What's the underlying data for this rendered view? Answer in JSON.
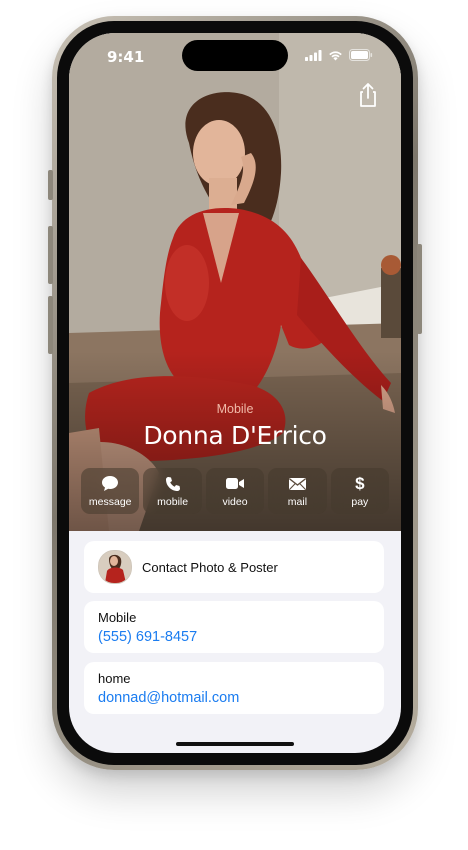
{
  "status_bar": {
    "time": "9:41"
  },
  "header": {
    "share_icon": "share-icon"
  },
  "contact": {
    "label": "Mobile",
    "name": "Donna D'Errico"
  },
  "actions": [
    {
      "label": "message",
      "icon": "message-bubble-icon"
    },
    {
      "label": "mobile",
      "icon": "phone-icon"
    },
    {
      "label": "video",
      "icon": "video-camera-icon"
    },
    {
      "label": "mail",
      "icon": "envelope-icon"
    },
    {
      "label": "pay",
      "icon": "dollar-icon",
      "glyph": "$"
    }
  ],
  "poster_card": {
    "label": "Contact Photo & Poster"
  },
  "fields": {
    "mobile": {
      "label": "Mobile",
      "value": "(555) 691-8457"
    },
    "home": {
      "label": "home",
      "value": "donnad@hotmail.com"
    }
  },
  "colors": {
    "link": "#1a7cf0",
    "label_accent": "#f0b9a8",
    "background": "#f2f2f7"
  }
}
